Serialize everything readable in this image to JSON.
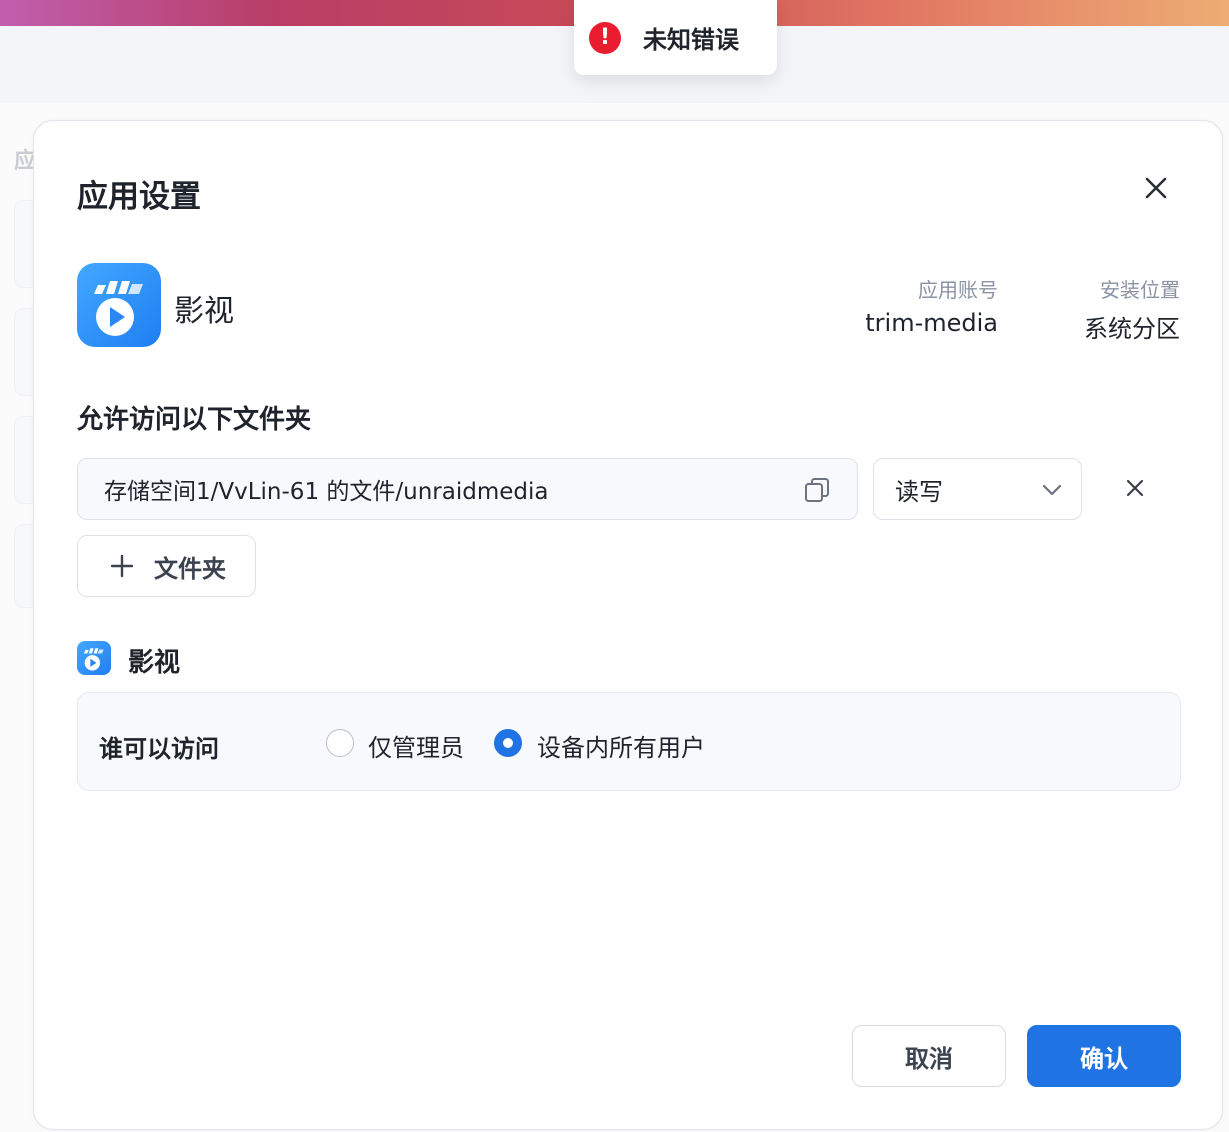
{
  "toast": {
    "message": "未知错误",
    "icon": "alert-circle-icon",
    "color": "#ea1c2f"
  },
  "background": {
    "title_fragment": "应"
  },
  "dialog": {
    "title": "应用设置",
    "app": {
      "name": "影视",
      "account_label": "应用账号",
      "account_value": "trim-media",
      "location_label": "安装位置",
      "location_value": "系统分区"
    },
    "folders_section_title": "允许访问以下文件夹",
    "folders": [
      {
        "path": "存储空间1/VvLin-61 的文件/unraidmedia",
        "permission": "读写"
      }
    ],
    "add_folder_label": "文件夹",
    "access_section": {
      "app_name": "影视",
      "label": "谁可以访问",
      "options": [
        {
          "label": "仅管理员",
          "selected": false
        },
        {
          "label": "设备内所有用户",
          "selected": true
        }
      ]
    },
    "buttons": {
      "cancel": "取消",
      "confirm": "确认"
    },
    "accent_color": "#1f73e2"
  }
}
